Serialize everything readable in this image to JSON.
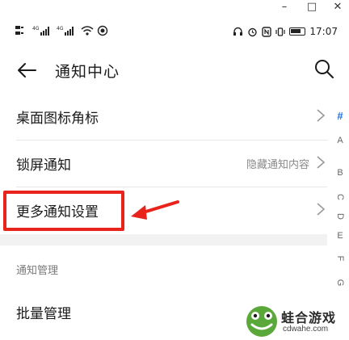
{
  "window": {
    "minimize": "–",
    "maximize": "□",
    "close": "✕"
  },
  "status_bar": {
    "left_text": "⁴ᴳ ‥ıll ⁴ᴳ‥ıll",
    "time": "17:07"
  },
  "header": {
    "title": "通知中心"
  },
  "rows": [
    {
      "label": "桌面图标角标",
      "value": ""
    },
    {
      "label": "锁屏通知",
      "value": "隐藏通知内容"
    },
    {
      "label": "更多通知设置",
      "value": ""
    }
  ],
  "section": {
    "title": "通知管理"
  },
  "bulk_row": {
    "label": "批量管理"
  },
  "index_letters": [
    "#",
    "A",
    "B",
    "C",
    "D",
    "E",
    "F",
    "G"
  ],
  "watermark": {
    "name": "蛙合游戏",
    "url": "cdwahe.com"
  },
  "colors": {
    "highlight": "#e8231c",
    "index_active": "#1a6fe0",
    "logo_green": "#5aa83a"
  }
}
